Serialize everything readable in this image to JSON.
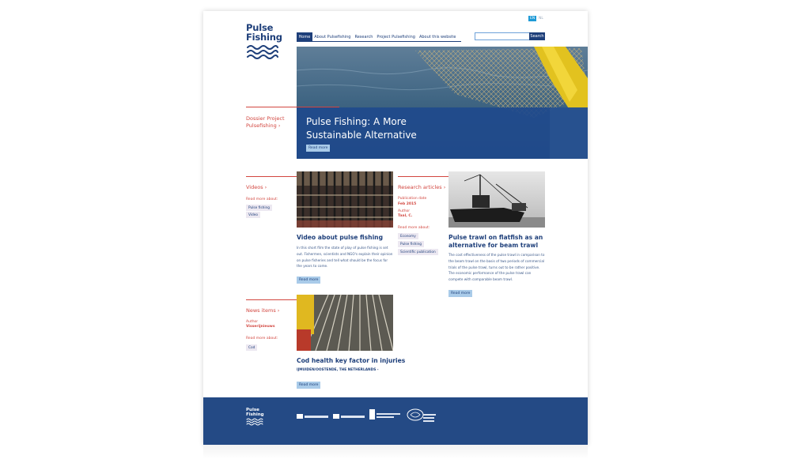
{
  "brand": {
    "line1": "Pulse",
    "line2": "Fishing"
  },
  "nav": [
    {
      "label": "Home"
    },
    {
      "label": "About Pulsefishing"
    },
    {
      "label": "Research"
    },
    {
      "label": "Project Pulsefishing"
    },
    {
      "label": "About this website"
    }
  ],
  "lang": {
    "en": "EN",
    "nl": "NL"
  },
  "search": {
    "value": "",
    "button": "Search"
  },
  "hero": {
    "dossier_link": "Dossier Project Pulsefishing ›",
    "title_line1": "Pulse Fishing: A More",
    "title_line2": "Sustainable Alternative",
    "read_more": "Read more"
  },
  "videos": {
    "section_link": "Videos ›",
    "read_more_about": "Read more about:",
    "tags": [
      "Pulse fishing",
      "Video"
    ],
    "article_title": "Video about pulse fishing",
    "article_text": "In this short film the state of play of pulse fishing is set out. Fishermen, scientists and NGO's explain their opinion on pulse fisheries and tell what should be the focus for the years to come.",
    "read_more": "Read more"
  },
  "research": {
    "section_link": "Research articles ›",
    "publication_date_label": "Publication date",
    "publication_date": "Feb 2015",
    "author_label": "Author",
    "author": "Taal, C.",
    "read_more_about": "Read more about:",
    "tags": [
      "Economy",
      "Pulse fishing",
      "Scientific publication"
    ],
    "article_title_line1": "Pulse trawl on flatfish as an",
    "article_title_line2": "alternative for beam trawl",
    "article_text": "The cost effectiveness of the pulse trawl in comparison to the beam trawl on the basis of two periods of commercial trials of the pulse trawl, turns out to be rather positive. The economic performance of the pulse trawl can compete with comparable beam trawl.",
    "read_more": "Read more"
  },
  "news": {
    "section_link": "News items ›",
    "author_label": "Author",
    "author": "Visserijnieuws",
    "read_more_about": "Read more about:",
    "tags": [
      "Cod"
    ],
    "article_title": "Cod health key factor in injuries",
    "dateline": "IJMUIDEN/OOSTENDE, THE NETHERLANDS -",
    "read_more": "Read more"
  },
  "footer": {
    "brand_line1": "Pulse",
    "brand_line2": "Fishing"
  },
  "colors": {
    "brand": "#1e3f7a",
    "accent_red": "#d2463f",
    "button_light": "#a9cbe9",
    "footer": "#244a85"
  }
}
